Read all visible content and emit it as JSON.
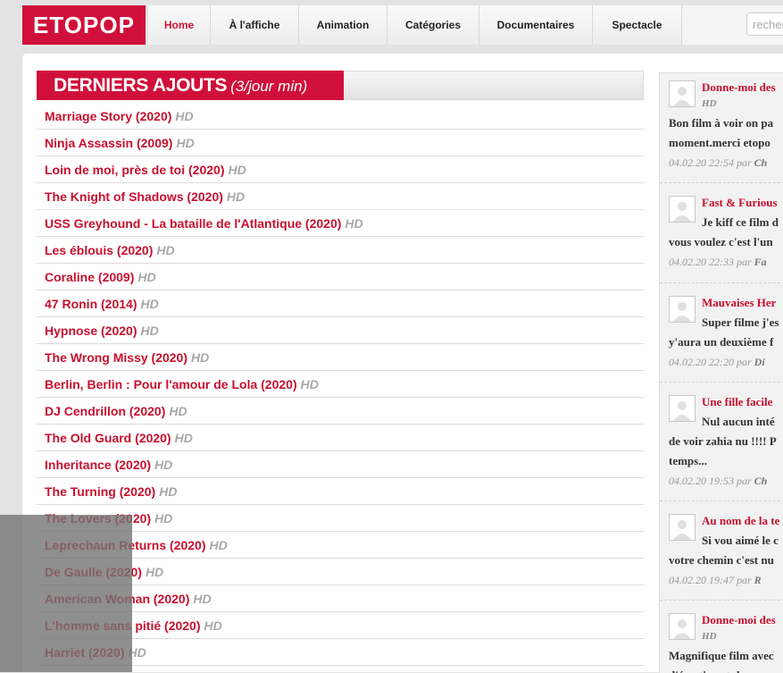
{
  "logo": "ETOPOP",
  "nav": [
    {
      "label": "Home",
      "active": true
    },
    {
      "label": "À l'affiche",
      "active": false
    },
    {
      "label": "Animation",
      "active": false
    },
    {
      "label": "Catégories",
      "active": false
    },
    {
      "label": "Documentaires",
      "active": false
    },
    {
      "label": "Spectacle",
      "active": false
    }
  ],
  "search": {
    "placeholder": "recherche"
  },
  "section": {
    "title": "DERNIERS AJOUTS",
    "subtitle": "(3/jour min)"
  },
  "films": [
    {
      "title": "Marriage Story (2020)",
      "quality": "HD"
    },
    {
      "title": "Ninja Assassin (2009)",
      "quality": "HD"
    },
    {
      "title": "Loin de moi, près de toi (2020)",
      "quality": "HD"
    },
    {
      "title": "The Knight of Shadows (2020)",
      "quality": "HD"
    },
    {
      "title": "USS Greyhound - La bataille de l'Atlantique (2020)",
      "quality": "HD"
    },
    {
      "title": "Les éblouis (2020)",
      "quality": "HD"
    },
    {
      "title": "Coraline (2009)",
      "quality": "HD"
    },
    {
      "title": "47 Ronin (2014)",
      "quality": "HD"
    },
    {
      "title": "Hypnose (2020)",
      "quality": "HD"
    },
    {
      "title": "The Wrong Missy (2020)",
      "quality": "HD"
    },
    {
      "title": "Berlin, Berlin : Pour l'amour de Lola (2020)",
      "quality": "HD"
    },
    {
      "title": "DJ Cendrillon (2020)",
      "quality": "HD"
    },
    {
      "title": "The Old Guard (2020)",
      "quality": "HD"
    },
    {
      "title": "Inheritance (2020)",
      "quality": "HD"
    },
    {
      "title": "The Turning (2020)",
      "quality": "HD"
    },
    {
      "title": "The Lovers (2020)",
      "quality": "HD"
    },
    {
      "title": "Leprechaun Returns (2020)",
      "quality": "HD"
    },
    {
      "title": "De Gaulle (2020)",
      "quality": "HD"
    },
    {
      "title": "American Woman (2020)",
      "quality": "HD"
    },
    {
      "title": "L'homme sans pitié (2020)",
      "quality": "HD"
    },
    {
      "title": "Harriet (2020)",
      "quality": "HD"
    }
  ],
  "comments": [
    {
      "title": "Donne-moi des",
      "hd": "HD",
      "line1": "Bon film à voir on pa",
      "line2": "moment.merci etopo",
      "date": "04.02.20 22:54",
      "by": "par",
      "author": "Ch"
    },
    {
      "title": "Fast & Furious",
      "hd": "",
      "line1": "Je kiff ce film d",
      "line2": "vous voulez c'est l'un",
      "date": "04.02.20 22:33",
      "by": "par",
      "author": "Fa"
    },
    {
      "title": "Mauvaises Her",
      "hd": "",
      "line1": "Super filme j'es",
      "line2": "y'aura un deuxième f",
      "date": "04.02.20 22:20",
      "by": "par",
      "author": "Di"
    },
    {
      "title": "Une fille facile",
      "hd": "",
      "line1": "Nul aucun inté",
      "line2": "de voir zahia nu !!!! P",
      "line3": "temps...",
      "date": "04.02.20 19:53",
      "by": "par",
      "author": "Ch"
    },
    {
      "title": "Au nom de la te",
      "hd": "",
      "line1": "Si vou aimé le c",
      "line2": "votre chemin c'est nu",
      "date": "04.02.20 19:47",
      "by": "par",
      "author": "R"
    },
    {
      "title": "Donne-moi des",
      "hd": "HD",
      "line1": "Magnifique film avec",
      "line2": "d'émotion et de",
      "date": "",
      "by": "",
      "author": ""
    }
  ]
}
